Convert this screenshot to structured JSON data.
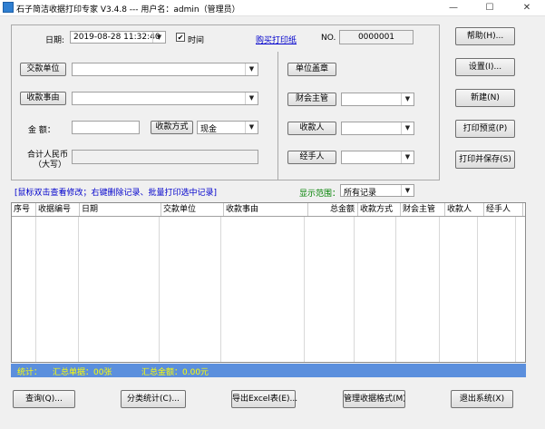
{
  "window": {
    "title": "石子简洁收据打印专家 V3.4.8 --- 用户名：admin（管理员）",
    "minimize": "—",
    "maximize": "☐",
    "close": "✕"
  },
  "form": {
    "date_label": "日期:",
    "date_value": "2019-08-28 11:32:40",
    "time_label": "时间",
    "buy_paper_link": "购买打印纸",
    "no_label": "NO.",
    "no_value": "0000001",
    "payer_button": "交款单位",
    "payer_value": "",
    "reason_button": "收款事由",
    "reason_value": "",
    "amount_label": "金    额：",
    "amount_value": "",
    "method_button": "收款方式",
    "method_value": "现金",
    "rmb_label_1": "合计人民币",
    "rmb_label_2": "（大写）",
    "rmb_value": "",
    "seal_button": "单位盖章",
    "finance_button": "财会主管",
    "receiver_button": "收款人",
    "handler_button": "经手人"
  },
  "side_buttons": {
    "help": "帮助(H)...",
    "settings": "设置(I)...",
    "new": "新建(N)",
    "preview": "打印预览(P)",
    "print_save": "打印并保存(S)"
  },
  "list": {
    "hint": "[鼠标双击查看修改；右键删除记录、批量打印选中记录]",
    "range_label": "显示范围：",
    "range_value": "所有记录",
    "columns": [
      "序号",
      "收据编号",
      "日期",
      "交款单位",
      "收款事由",
      "总金额",
      "收款方式",
      "财会主管",
      "收款人",
      "经手人"
    ]
  },
  "status": {
    "stats_label": "统计：",
    "count_text": "汇总单据：00张",
    "amount_text": "汇总金额：0.00元"
  },
  "bottom_buttons": {
    "query": "查询(Q)...",
    "classify": "分类统计(C)...",
    "export": "导出Excel表(E)...",
    "manage": "管理收据格式(M)...",
    "exit": "退出系统(X)"
  },
  "colors": {
    "status_bg": "#5b8fdd",
    "status_text": "#ffff00",
    "link": "#0000cc",
    "green_label": "#008000",
    "hint_blue": "#0000cc"
  }
}
